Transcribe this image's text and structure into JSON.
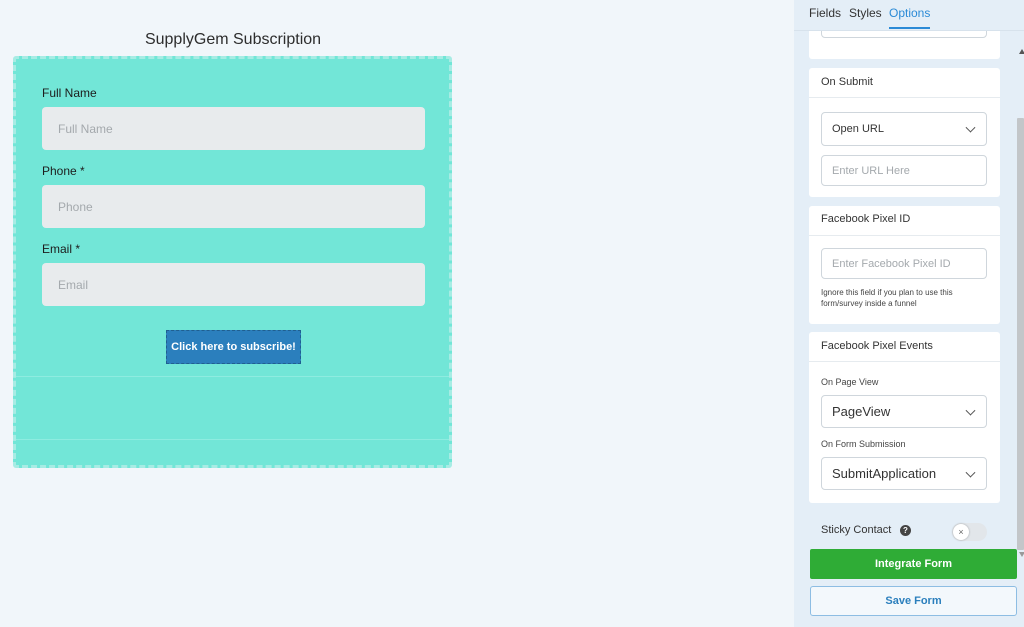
{
  "form": {
    "title": "SupplyGem Subscription",
    "fields": [
      {
        "label": "Full Name",
        "placeholder": "Full Name"
      },
      {
        "label": "Phone *",
        "placeholder": "Phone"
      },
      {
        "label": "Email *",
        "placeholder": "Email"
      }
    ],
    "submit_label": "Click here to subscribe!",
    "colors": {
      "background": "#72e6d7",
      "button": "#2b7fbd"
    }
  },
  "panel": {
    "tabs": [
      {
        "label": "Fields",
        "active": false
      },
      {
        "label": "Styles",
        "active": false
      },
      {
        "label": "Options",
        "active": true
      }
    ],
    "on_submit": {
      "title": "On Submit",
      "action_value": "Open URL",
      "url_placeholder": "Enter URL Here"
    },
    "pixel_id": {
      "title": "Facebook Pixel ID",
      "placeholder": "Enter Facebook Pixel ID",
      "help": "Ignore this field if you plan to use this form/survey inside a funnel"
    },
    "pixel_events": {
      "title": "Facebook Pixel Events",
      "page_view_label": "On Page View",
      "page_view_value": "PageView",
      "submission_label": "On Form Submission",
      "submission_value": "SubmitApplication"
    },
    "sticky_contact": {
      "label": "Sticky Contact",
      "help_icon": "question-circle-icon",
      "enabled": false,
      "toggle_glyph": "×"
    },
    "integrate_label": "Integrate Form",
    "save_label": "Save Form",
    "colors": {
      "accent": "#2b8ad6",
      "integrate": "#2fac36"
    }
  }
}
